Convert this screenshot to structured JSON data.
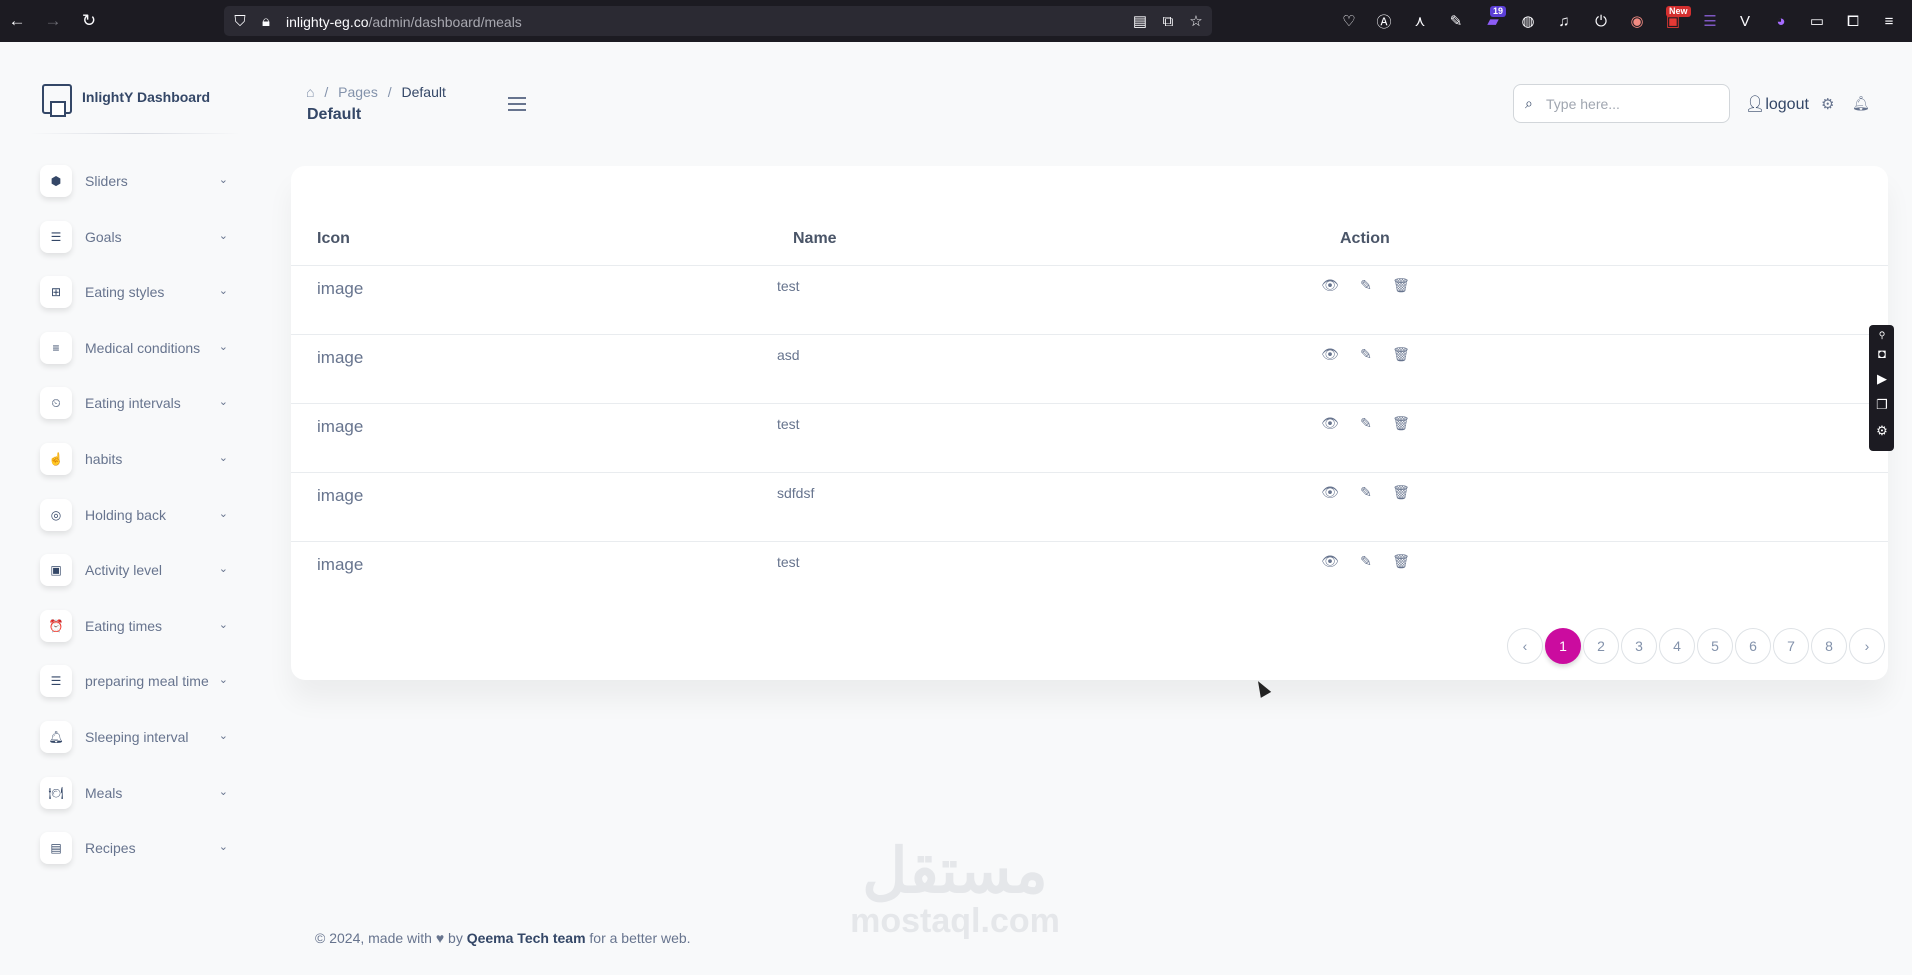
{
  "browser": {
    "url_domain": "inlighty-eg.co",
    "url_path": "/admin/dashboard/meals",
    "badge_count": "19",
    "badge_new": "New"
  },
  "brand": {
    "name": "InlightY Dashboard"
  },
  "sidebar": {
    "items": [
      {
        "label": "Sliders",
        "icon": "cube-icon"
      },
      {
        "label": "Goals",
        "icon": "list-icon"
      },
      {
        "label": "Eating styles",
        "icon": "grid-icon"
      },
      {
        "label": "Medical conditions",
        "icon": "align-icon"
      },
      {
        "label": "Eating intervals",
        "icon": "timer-icon"
      },
      {
        "label": "habits",
        "icon": "hand-icon"
      },
      {
        "label": "Holding back",
        "icon": "lifebuoy-icon"
      },
      {
        "label": "Activity level",
        "icon": "bag-icon"
      },
      {
        "label": "Eating times",
        "icon": "alarm-icon"
      },
      {
        "label": "preparing meal time",
        "icon": "list-icon"
      },
      {
        "label": "Sleeping interval",
        "icon": "bell-icon"
      },
      {
        "label": "Meals",
        "icon": "plate-icon"
      },
      {
        "label": "Recipes",
        "icon": "recipe-icon"
      }
    ]
  },
  "header": {
    "crumb_pages": "Pages",
    "crumb_current": "Default",
    "title": "Default",
    "search_placeholder": "Type here...",
    "logout": "logout"
  },
  "table": {
    "columns": [
      "Icon",
      "Name",
      "Action"
    ],
    "rows": [
      {
        "icon": "image",
        "name": "test"
      },
      {
        "icon": "image",
        "name": "asd"
      },
      {
        "icon": "image",
        "name": "test"
      },
      {
        "icon": "image",
        "name": "sdfdsf"
      },
      {
        "icon": "image",
        "name": "test"
      }
    ]
  },
  "pagination": {
    "prev": "‹",
    "pages": [
      "1",
      "2",
      "3",
      "4",
      "5",
      "6",
      "7",
      "8"
    ],
    "active": "1",
    "next": "›"
  },
  "footer": {
    "prefix": "© 2024, made with",
    "by": "by",
    "team": "Qeema Tech team",
    "suffix": "for a better web."
  },
  "watermark": {
    "arabic": "مستقل",
    "latin": "mostaql.com"
  },
  "colors": {
    "accent": "#cb0c9f",
    "heading": "#344767",
    "text": "#67748e"
  }
}
